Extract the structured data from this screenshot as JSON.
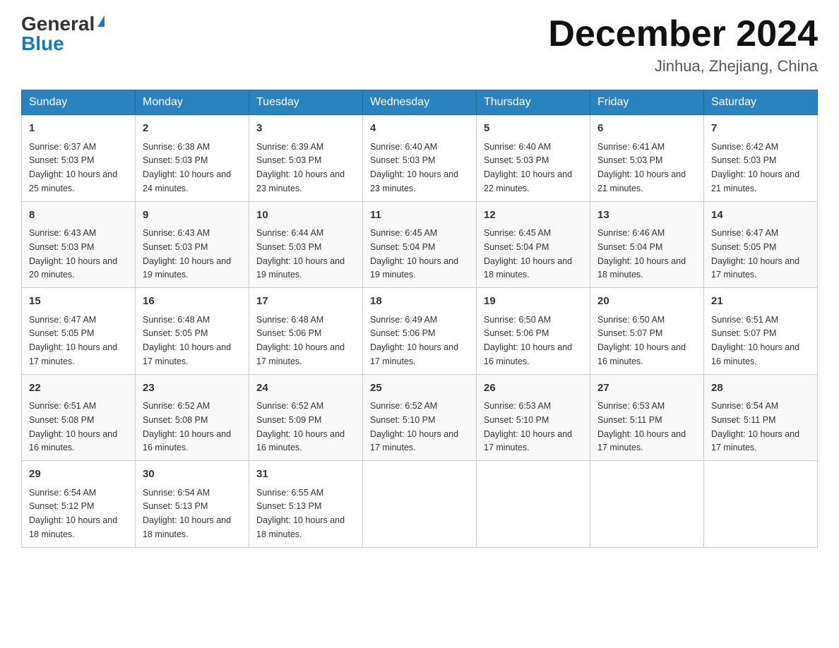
{
  "logo": {
    "general": "General",
    "blue": "Blue",
    "triangle": "▶"
  },
  "title": "December 2024",
  "location": "Jinhua, Zhejiang, China",
  "headers": [
    "Sunday",
    "Monday",
    "Tuesday",
    "Wednesday",
    "Thursday",
    "Friday",
    "Saturday"
  ],
  "weeks": [
    [
      {
        "day": "1",
        "sunrise": "6:37 AM",
        "sunset": "5:03 PM",
        "daylight": "10 hours and 25 minutes."
      },
      {
        "day": "2",
        "sunrise": "6:38 AM",
        "sunset": "5:03 PM",
        "daylight": "10 hours and 24 minutes."
      },
      {
        "day": "3",
        "sunrise": "6:39 AM",
        "sunset": "5:03 PM",
        "daylight": "10 hours and 23 minutes."
      },
      {
        "day": "4",
        "sunrise": "6:40 AM",
        "sunset": "5:03 PM",
        "daylight": "10 hours and 23 minutes."
      },
      {
        "day": "5",
        "sunrise": "6:40 AM",
        "sunset": "5:03 PM",
        "daylight": "10 hours and 22 minutes."
      },
      {
        "day": "6",
        "sunrise": "6:41 AM",
        "sunset": "5:03 PM",
        "daylight": "10 hours and 21 minutes."
      },
      {
        "day": "7",
        "sunrise": "6:42 AM",
        "sunset": "5:03 PM",
        "daylight": "10 hours and 21 minutes."
      }
    ],
    [
      {
        "day": "8",
        "sunrise": "6:43 AM",
        "sunset": "5:03 PM",
        "daylight": "10 hours and 20 minutes."
      },
      {
        "day": "9",
        "sunrise": "6:43 AM",
        "sunset": "5:03 PM",
        "daylight": "10 hours and 19 minutes."
      },
      {
        "day": "10",
        "sunrise": "6:44 AM",
        "sunset": "5:03 PM",
        "daylight": "10 hours and 19 minutes."
      },
      {
        "day": "11",
        "sunrise": "6:45 AM",
        "sunset": "5:04 PM",
        "daylight": "10 hours and 19 minutes."
      },
      {
        "day": "12",
        "sunrise": "6:45 AM",
        "sunset": "5:04 PM",
        "daylight": "10 hours and 18 minutes."
      },
      {
        "day": "13",
        "sunrise": "6:46 AM",
        "sunset": "5:04 PM",
        "daylight": "10 hours and 18 minutes."
      },
      {
        "day": "14",
        "sunrise": "6:47 AM",
        "sunset": "5:05 PM",
        "daylight": "10 hours and 17 minutes."
      }
    ],
    [
      {
        "day": "15",
        "sunrise": "6:47 AM",
        "sunset": "5:05 PM",
        "daylight": "10 hours and 17 minutes."
      },
      {
        "day": "16",
        "sunrise": "6:48 AM",
        "sunset": "5:05 PM",
        "daylight": "10 hours and 17 minutes."
      },
      {
        "day": "17",
        "sunrise": "6:48 AM",
        "sunset": "5:06 PM",
        "daylight": "10 hours and 17 minutes."
      },
      {
        "day": "18",
        "sunrise": "6:49 AM",
        "sunset": "5:06 PM",
        "daylight": "10 hours and 17 minutes."
      },
      {
        "day": "19",
        "sunrise": "6:50 AM",
        "sunset": "5:06 PM",
        "daylight": "10 hours and 16 minutes."
      },
      {
        "day": "20",
        "sunrise": "6:50 AM",
        "sunset": "5:07 PM",
        "daylight": "10 hours and 16 minutes."
      },
      {
        "day": "21",
        "sunrise": "6:51 AM",
        "sunset": "5:07 PM",
        "daylight": "10 hours and 16 minutes."
      }
    ],
    [
      {
        "day": "22",
        "sunrise": "6:51 AM",
        "sunset": "5:08 PM",
        "daylight": "10 hours and 16 minutes."
      },
      {
        "day": "23",
        "sunrise": "6:52 AM",
        "sunset": "5:08 PM",
        "daylight": "10 hours and 16 minutes."
      },
      {
        "day": "24",
        "sunrise": "6:52 AM",
        "sunset": "5:09 PM",
        "daylight": "10 hours and 16 minutes."
      },
      {
        "day": "25",
        "sunrise": "6:52 AM",
        "sunset": "5:10 PM",
        "daylight": "10 hours and 17 minutes."
      },
      {
        "day": "26",
        "sunrise": "6:53 AM",
        "sunset": "5:10 PM",
        "daylight": "10 hours and 17 minutes."
      },
      {
        "day": "27",
        "sunrise": "6:53 AM",
        "sunset": "5:11 PM",
        "daylight": "10 hours and 17 minutes."
      },
      {
        "day": "28",
        "sunrise": "6:54 AM",
        "sunset": "5:11 PM",
        "daylight": "10 hours and 17 minutes."
      }
    ],
    [
      {
        "day": "29",
        "sunrise": "6:54 AM",
        "sunset": "5:12 PM",
        "daylight": "10 hours and 18 minutes."
      },
      {
        "day": "30",
        "sunrise": "6:54 AM",
        "sunset": "5:13 PM",
        "daylight": "10 hours and 18 minutes."
      },
      {
        "day": "31",
        "sunrise": "6:55 AM",
        "sunset": "5:13 PM",
        "daylight": "10 hours and 18 minutes."
      },
      null,
      null,
      null,
      null
    ]
  ]
}
